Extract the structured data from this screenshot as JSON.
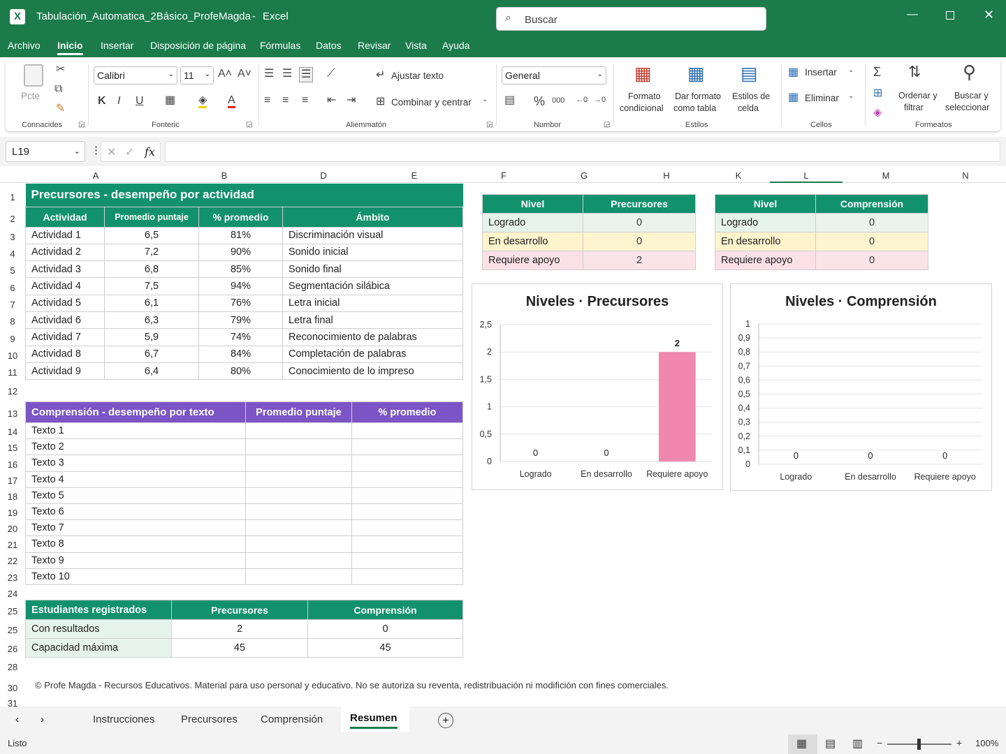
{
  "app": {
    "title": "Tabulación_Automatica_2Básico_ProfeMagda",
    "app_name": "Excel",
    "search_placeholder": "Buscar",
    "accent": "#1b7b4b"
  },
  "menu": [
    "Archivo",
    "Inicio",
    "Insertar",
    "Disposición de página",
    "Fórmulas",
    "Datos",
    "Revisar",
    "Vista",
    "Ayuda"
  ],
  "ribbon": {
    "paste": "Pcte",
    "clipboard": "Connacides",
    "font_name": "Calibri",
    "font_size": "11",
    "bold": "K",
    "italic": "I",
    "underline": "U",
    "font_group": "Fonteric",
    "wrap": "Ajustar texto",
    "merge": "Combinar y centrar",
    "align_group": "Aliemmatón",
    "number_format": "General",
    "number_group": "Numbor",
    "cond_format_1": "Formato",
    "cond_format_2": "condicional",
    "table_fmt_1": "Dar formato",
    "table_fmt_2": "como tabla",
    "cell_styles_1": "Estilos de",
    "cell_styles_2": "celda",
    "styles_group": "Estilos",
    "insert": "Insertar",
    "delete": "Eliminar",
    "cells_group": "Cellos",
    "sort_1": "Ordenar y",
    "sort_2": "filtrar",
    "find_1": "Buscar y",
    "find_2": "seleccionar",
    "edit_group": "Formeatos"
  },
  "formula_bar": {
    "cell_ref": "L19",
    "fx": "fx",
    "value": ""
  },
  "columns": [
    "A",
    "B",
    "D",
    "E",
    "F",
    "G",
    "H",
    "K",
    "L",
    "M",
    "N"
  ],
  "rows": [
    "1",
    "2",
    "3",
    "4",
    "5",
    "6",
    "7",
    "8",
    "9",
    "10",
    "11",
    "12",
    "13",
    "14",
    "15",
    "16",
    "17",
    "18",
    "19",
    "20",
    "21",
    "22",
    "23",
    "24",
    "25",
    "25",
    "26",
    "28",
    "30",
    "31"
  ],
  "precursores_table": {
    "title": "Precursores - desempeño por actividad",
    "headers": [
      "Actividad",
      "Promedio puntaje",
      "% promedio",
      "Ámbito"
    ],
    "rows": [
      [
        "Actividad 1",
        "6,5",
        "81%",
        "Discriminación visual"
      ],
      [
        "Actividad 2",
        "7,2",
        "90%",
        "Sonido inicial"
      ],
      [
        "Actividad 3",
        "6,8",
        "85%",
        "Sonido final"
      ],
      [
        "Actividad 4",
        "7,5",
        "94%",
        "Segmentación silábica"
      ],
      [
        "Actividad 5",
        "6,1",
        "76%",
        "Letra inicial"
      ],
      [
        "Actividad 6",
        "6,3",
        "79%",
        "Letra final"
      ],
      [
        "Actividad 7",
        "5,9",
        "74%",
        "Reconocimiento de palabras"
      ],
      [
        "Actividad 8",
        "6,7",
        "84%",
        "Completación de palabras"
      ],
      [
        "Actividad 9",
        "6,4",
        "80%",
        "Conocimiento de lo impreso"
      ]
    ]
  },
  "comprension_table": {
    "headers": [
      "Comprensión - desempeño por texto",
      "Promedio puntaje",
      "% promedio"
    ],
    "rows": [
      "Texto 1",
      "Texto 2",
      "Texto 3",
      "Texto 4",
      "Texto 5",
      "Texto 6",
      "Texto 7",
      "Texto 8",
      "Texto 9",
      "Texto 10"
    ]
  },
  "estudiantes_table": {
    "headers": [
      "Estudiantes registrados",
      "Precursores",
      "Comprensión"
    ],
    "rows": [
      [
        "Con resultados",
        "2",
        "0"
      ],
      [
        "Capacidad máxima",
        "45",
        "45"
      ]
    ]
  },
  "nivel_precursores": {
    "headers": [
      "Nivel",
      "Precursores"
    ],
    "rows": [
      [
        "Logrado",
        "0"
      ],
      [
        "En desarrollo",
        "0"
      ],
      [
        "Requiere apoyo",
        "2"
      ]
    ]
  },
  "nivel_comprension": {
    "headers": [
      "Nivel",
      "Comprensión"
    ],
    "rows": [
      [
        "Logrado",
        "0"
      ],
      [
        "En desarrollo",
        "0"
      ],
      [
        "Requiere apoyo",
        "0"
      ]
    ]
  },
  "colors": {
    "green_header": "#12916d",
    "purple_header": "#7b55c6",
    "logrado": "#e6f3ea",
    "desarrollo": "#fdf3cc",
    "apoyo": "#fbe0e8",
    "bar": "#f087ae"
  },
  "chart_data": [
    {
      "type": "bar",
      "title": "Niveles · Precursores",
      "categories": [
        "Logrado",
        "En desarrollo",
        "Requiere apoyo"
      ],
      "values": [
        0,
        0,
        2
      ],
      "ylim": [
        0,
        2.5
      ],
      "yticks": [
        "0",
        "0,5",
        "1",
        "1,5",
        "2",
        "2,5"
      ],
      "labels": [
        "0",
        "0",
        "2"
      ]
    },
    {
      "type": "bar",
      "title": "Niveles · Comprensión",
      "categories": [
        "Logrado",
        "En desarrollo",
        "Requiere apoyo"
      ],
      "values": [
        0,
        0,
        0
      ],
      "ylim": [
        0,
        1
      ],
      "yticks": [
        "0",
        "0,1",
        "0,2",
        "0,3",
        "0,4",
        "0,5",
        "0,6",
        "0,7",
        "0,8",
        "0,9",
        "1"
      ],
      "labels": [
        "0",
        "0",
        "0"
      ]
    }
  ],
  "footer_note": "© Profe Magda - Recursos Educativos. Material para uso personal y educativo. No se autoriza su reventa, redistribuación ni modifición con fines comerciales.",
  "sheets": [
    "Instrucciones",
    "Precursores",
    "Comprensión",
    "Resumen"
  ],
  "status": {
    "ready": "Listo",
    "zoom": "100%"
  }
}
